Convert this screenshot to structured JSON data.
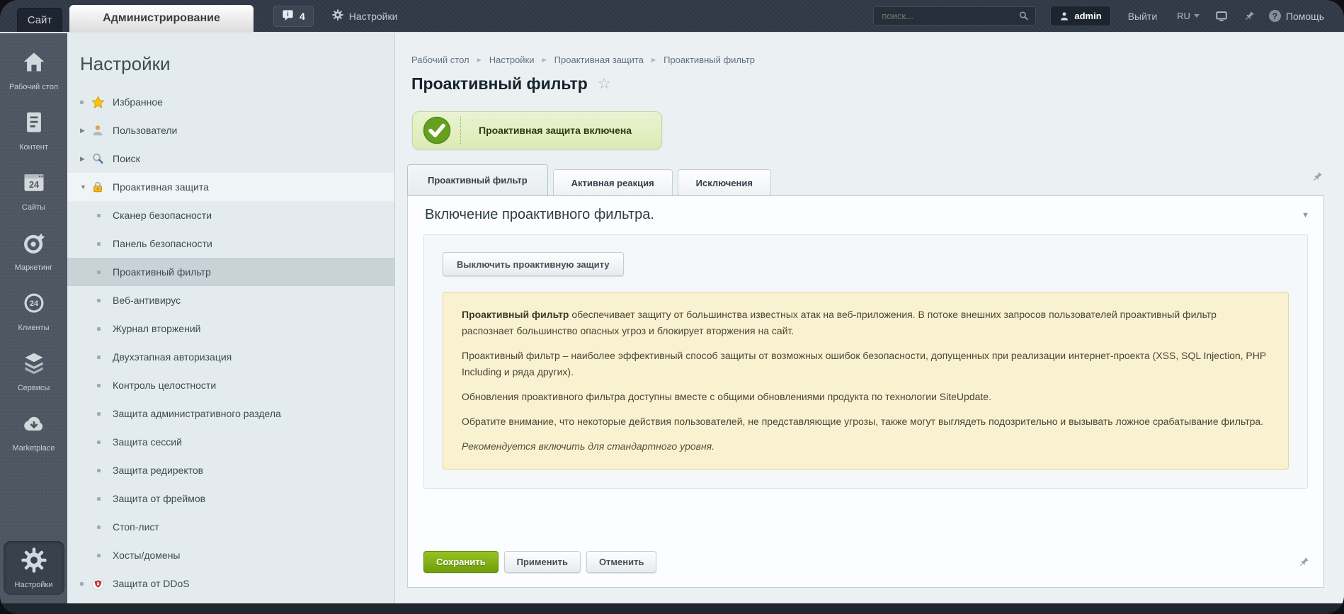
{
  "topbar": {
    "site_tab": "Сайт",
    "admin_tab": "Администрирование",
    "notifications_count": "4",
    "settings_label": "Настройки",
    "search_placeholder": "поиск...",
    "user": "admin",
    "logout": "Выйти",
    "language": "RU",
    "help": "Помощь"
  },
  "rail": {
    "items": [
      {
        "icon": "home-icon",
        "label": "Рабочий стол"
      },
      {
        "icon": "content-icon",
        "label": "Контент"
      },
      {
        "icon": "sites-icon",
        "label": "Сайты"
      },
      {
        "icon": "marketing-icon",
        "label": "Маркетинг"
      },
      {
        "icon": "clients-icon",
        "label": "Клиенты"
      },
      {
        "icon": "services-icon",
        "label": "Сервисы"
      },
      {
        "icon": "marketplace-icon",
        "label": "Marketplace"
      },
      {
        "icon": "settings-icon",
        "label": "Настройки",
        "active": true
      }
    ]
  },
  "menu": {
    "heading": "Настройки",
    "items": [
      {
        "label": "Избранное",
        "marker": "bullet",
        "icon": "star-icon",
        "level": 0
      },
      {
        "label": "Пользователи",
        "marker": "arrow-right",
        "icon": "user-icon",
        "level": 0
      },
      {
        "label": "Поиск",
        "marker": "arrow-right",
        "icon": "search-icon",
        "level": 0
      },
      {
        "label": "Проактивная защита",
        "marker": "arrow-down",
        "icon": "lock-icon",
        "level": 0,
        "state": "expanded"
      },
      {
        "label": "Сканер безопасности",
        "marker": "bullet",
        "level": 1
      },
      {
        "label": "Панель безопасности",
        "marker": "bullet",
        "level": 1
      },
      {
        "label": "Проактивный фильтр",
        "marker": "bullet",
        "level": 1,
        "state": "selected"
      },
      {
        "label": "Веб-антивирус",
        "marker": "bullet",
        "level": 1
      },
      {
        "label": "Журнал вторжений",
        "marker": "bullet",
        "level": 1
      },
      {
        "label": "Двухэтапная авторизация",
        "marker": "bullet",
        "level": 1
      },
      {
        "label": "Контроль целостности",
        "marker": "bullet",
        "level": 1
      },
      {
        "label": "Защита административного раздела",
        "marker": "bullet",
        "level": 1
      },
      {
        "label": "Защита сессий",
        "marker": "bullet",
        "level": 1
      },
      {
        "label": "Защита редиректов",
        "marker": "bullet",
        "level": 1
      },
      {
        "label": "Защита от фреймов",
        "marker": "bullet",
        "level": 1
      },
      {
        "label": "Стоп-лист",
        "marker": "bullet",
        "level": 1
      },
      {
        "label": "Хосты/домены",
        "marker": "bullet",
        "level": 1
      },
      {
        "label": "Защита от DDoS",
        "marker": "bullet",
        "icon": "shield-icon",
        "level": 0
      }
    ]
  },
  "content": {
    "breadcrumb": [
      "Рабочий стол",
      "Настройки",
      "Проактивная защита",
      "Проактивный фильтр"
    ],
    "page_title": "Проактивный фильтр",
    "status_banner": "Проактивная защита включена",
    "tabs": [
      {
        "label": "Проактивный фильтр",
        "active": true
      },
      {
        "label": "Активная реакция",
        "active": false
      },
      {
        "label": "Исключения",
        "active": false
      }
    ],
    "section_title": "Включение проактивного фильтра.",
    "toggle_button": "Выключить проактивную защиту",
    "info_paragraphs": [
      {
        "lead": "Проактивный фильтр",
        "text": " обеспечивает защиту от большинства известных атак на веб-приложения. В потоке внешних запросов пользователей проактивный фильтр распознает большинство опасных угроз и блокирует вторжения на сайт."
      },
      {
        "text": "Проактивный фильтр – наиболее эффективный способ защиты от возможных ошибок безопасности, допущенных при реализации интернет-проекта (XSS, SQL Injection, PHP Including и ряда других)."
      },
      {
        "text": "Обновления проактивного фильтра доступны вместе с общими обновлениями продукта по технологии SiteUpdate."
      },
      {
        "text": "Обратите внимание, что некоторые действия пользователей, не представляющие угрозы, также могут выглядеть подозрительно и вызывать ложное срабатывание фильтра."
      },
      {
        "text": "Рекомендуется включить для стандартного уровня.",
        "italic": true
      }
    ],
    "actions": [
      {
        "label": "Сохранить",
        "style": "primary"
      },
      {
        "label": "Применить",
        "style": "default"
      },
      {
        "label": "Отменить",
        "style": "default"
      }
    ]
  },
  "colors": {
    "topbar_bg": "#313947",
    "rail_bg": "#4d5661",
    "menu_bg": "#e4ebee",
    "selected_menu_item_bg": "#c8d2d7",
    "banner_bg": "#e0edbc",
    "banner_check_green": "#65a01e",
    "accent_button_green": "#76a800",
    "warning_box_bg": "#f8f2d0"
  }
}
